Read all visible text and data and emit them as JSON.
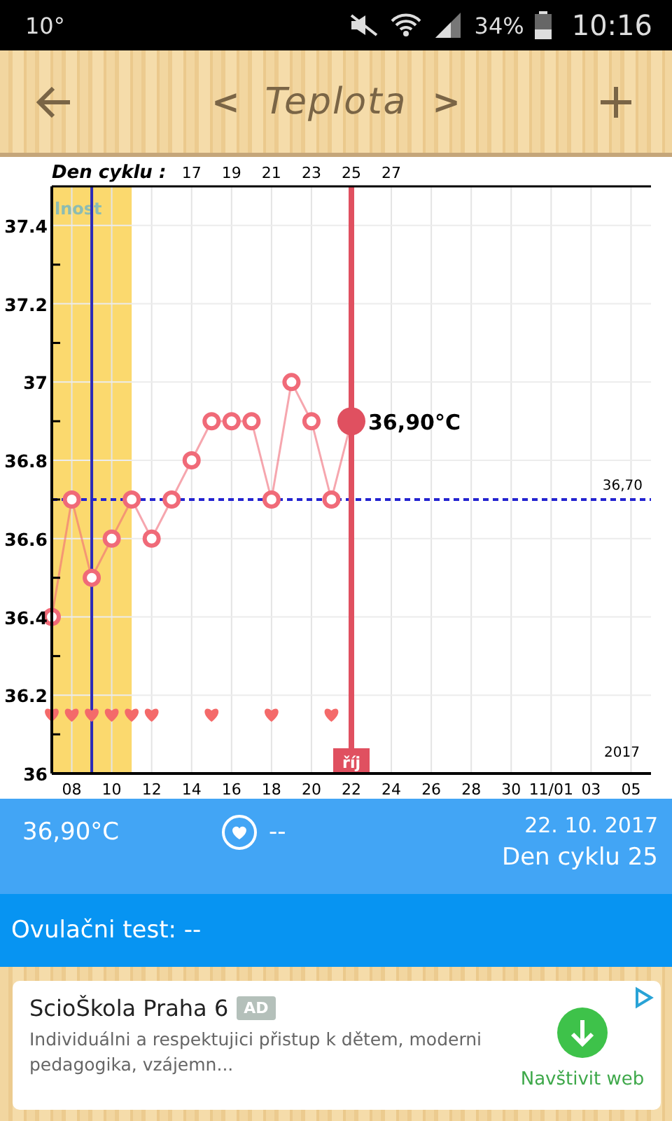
{
  "status_bar": {
    "temperature": "10°",
    "battery_percent": "34%",
    "time": "10:16"
  },
  "header": {
    "title": "Teplota",
    "prev": "<",
    "next": ">"
  },
  "chart": {
    "chart_data": {
      "type": "line",
      "categories": [
        null,
        "08",
        null,
        "10",
        null,
        "12",
        null,
        "14",
        null,
        "16",
        null,
        "18",
        null,
        "20",
        null,
        "22",
        null,
        "24",
        null,
        "26",
        null,
        "28",
        null,
        "30",
        null,
        "11/01",
        null,
        "03",
        null,
        "05",
        null
      ],
      "series": [
        {
          "type": "line",
          "color": "#f06a78",
          "marker": "circle",
          "values": [
            36.4,
            36.7,
            36.5,
            36.6,
            36.7,
            36.6,
            36.7,
            36.8,
            36.9,
            36.9,
            36.9,
            36.7,
            37.0,
            36.9,
            36.7,
            36.9,
            null,
            null,
            null,
            null,
            null,
            null,
            null,
            null,
            null,
            null,
            null,
            null,
            null,
            null,
            null
          ]
        },
        {
          "type": "scatter",
          "color": "#f46a6a",
          "values": [
            36.15,
            36.15,
            36.15,
            36.15,
            36.15,
            36.15,
            null,
            null,
            36.15,
            null,
            null,
            36.15,
            null,
            null,
            36.15,
            null,
            null,
            null,
            null,
            null,
            null,
            null,
            null,
            null,
            null,
            null,
            null,
            null,
            null,
            null,
            null
          ]
        }
      ],
      "ylim": [
        36,
        37.5
      ],
      "yticks": [
        {
          "value": 36,
          "label": "36"
        },
        {
          "value": 36.2,
          "label": "36.2"
        },
        {
          "value": 36.4,
          "label": "36.4"
        },
        {
          "value": 36.6,
          "label": "36.6"
        },
        {
          "value": 36.8,
          "label": "36.8"
        },
        {
          "value": 37,
          "label": "37"
        },
        {
          "value": 37.2,
          "label": "37.2"
        },
        {
          "value": 37.4,
          "label": "37.4"
        }
      ],
      "grid": true,
      "ref_lines": [
        {
          "axis": "y",
          "value": 36.7,
          "label": "36,70",
          "color": "#2424d0"
        },
        {
          "axis": "x",
          "value": "22",
          "label": "říj",
          "color": "#e05060"
        }
      ]
    },
    "band_label": "lnost",
    "cycle_day_title": "Den cyklu :",
    "cycle_day_labels": [
      "17",
      "19",
      "21",
      "23",
      "25",
      "27"
    ],
    "selected_label": "36,90°C",
    "year_label": "2017"
  },
  "info": {
    "temperature": "36,90°C",
    "intercourse": "--",
    "date": "22. 10. 2017",
    "cycle_day": "Den cyklu 25"
  },
  "ovulation_test": {
    "label": "Ovulačni test: --"
  },
  "ad": {
    "title": "ScioŠkola Praha 6",
    "badge": "AD",
    "text": "Individuálni a respektujici přistup k dětem, moderni pedagogika, vzájemn...",
    "action": "Navštivit web"
  }
}
